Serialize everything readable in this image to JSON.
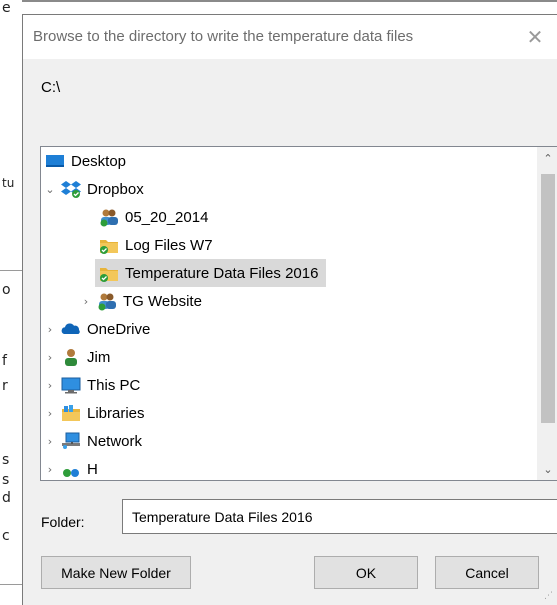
{
  "background": {
    "chars": [
      "e",
      "tu",
      "o",
      "f",
      "r",
      "s",
      "s",
      "d",
      "c"
    ]
  },
  "dialog": {
    "title": "Browse to the directory to write the temperature data files",
    "close_glyph": "✕",
    "path": "C:\\",
    "tree": {
      "items": [
        {
          "label": "Desktop",
          "icon": "desktop-icon",
          "chevron": ""
        },
        {
          "label": "Dropbox",
          "icon": "dropbox-icon",
          "chevron": "expanded"
        },
        {
          "label": "05_20_2014",
          "icon": "shared-folder-icon",
          "chevron": ""
        },
        {
          "label": "Log Files W7",
          "icon": "synced-folder-icon",
          "chevron": ""
        },
        {
          "label": "Temperature Data Files 2016",
          "icon": "synced-folder-icon",
          "chevron": "",
          "selected": true
        },
        {
          "label": "TG Website",
          "icon": "shared-folder-icon",
          "chevron": "collapsed"
        },
        {
          "label": "OneDrive",
          "icon": "onedrive-icon",
          "chevron": "collapsed"
        },
        {
          "label": "Jim",
          "icon": "user-icon",
          "chevron": "collapsed"
        },
        {
          "label": "This PC",
          "icon": "computer-icon",
          "chevron": "collapsed"
        },
        {
          "label": "Libraries",
          "icon": "libraries-icon",
          "chevron": "collapsed"
        },
        {
          "label": "Network",
          "icon": "network-icon",
          "chevron": "collapsed"
        },
        {
          "label": "H",
          "icon": "homegroup-icon",
          "chevron": "collapsed"
        }
      ]
    },
    "folder_label": "Folder:",
    "folder_value": "Temperature Data Files 2016",
    "buttons": {
      "make_new_folder": "Make New Folder",
      "ok": "OK",
      "cancel": "Cancel"
    }
  },
  "colors": {
    "selection": "#d9d9d9",
    "dialog_bg": "#f0f0f0",
    "folder_yellow": "#e8b43a",
    "sync_green": "#2e9d3a",
    "dropbox_blue": "#1f7fd6"
  }
}
